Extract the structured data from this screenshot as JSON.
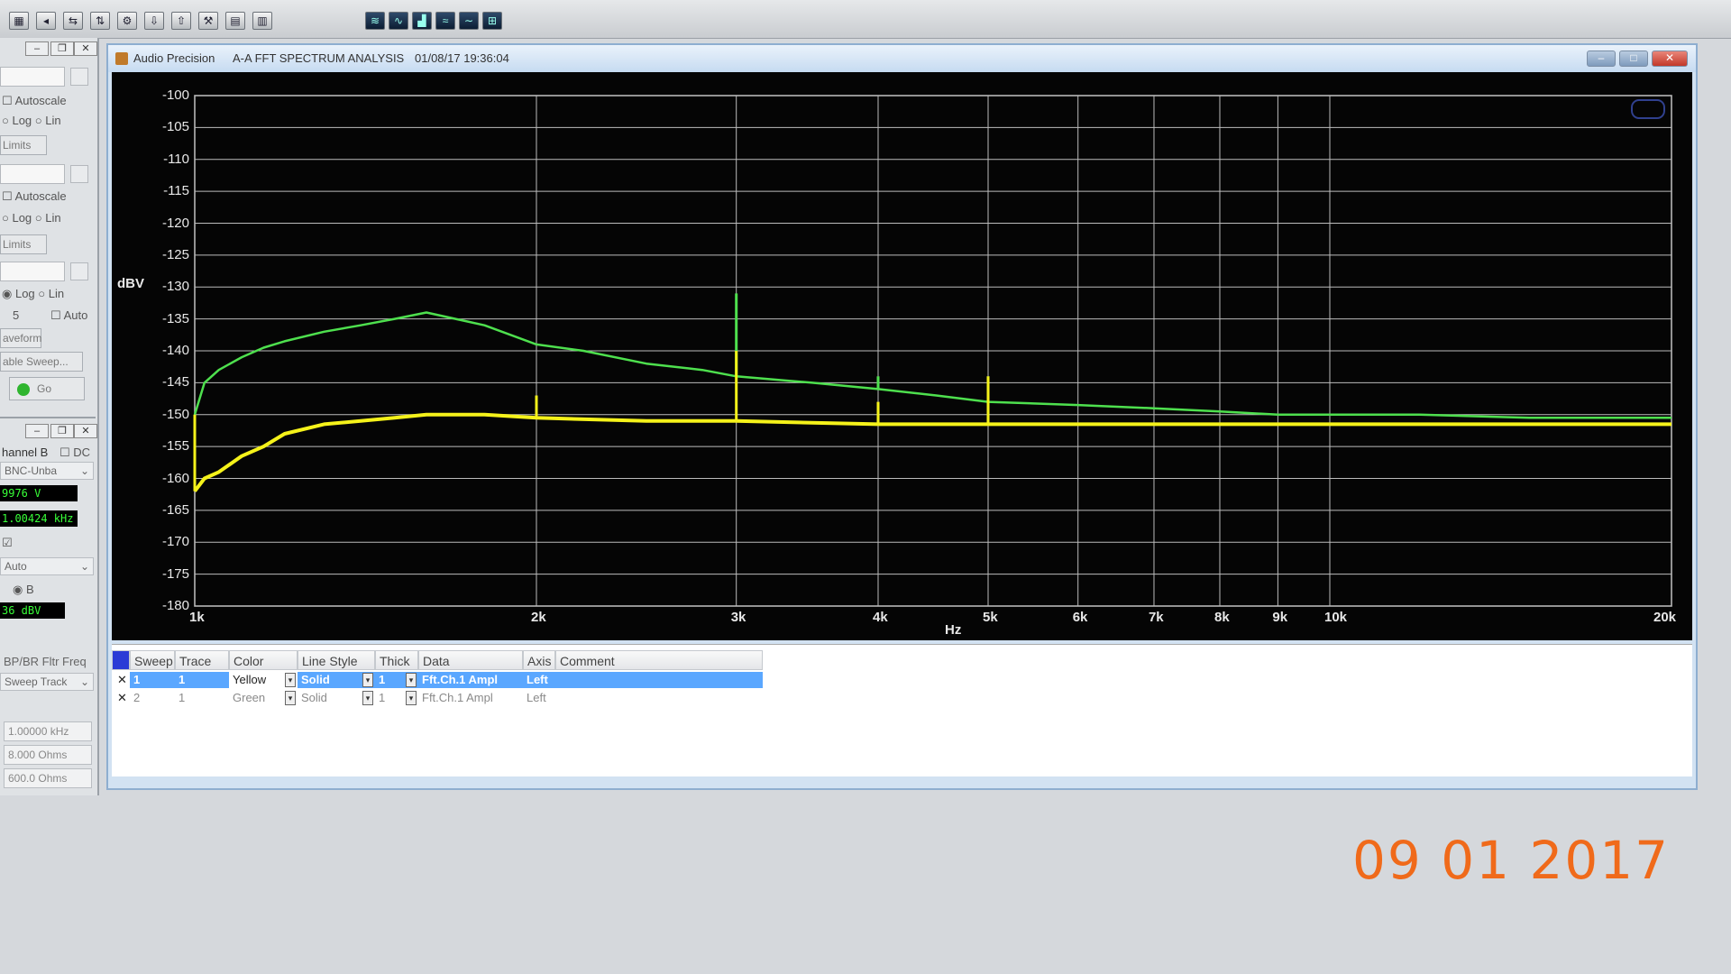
{
  "toolbar": {
    "icons": [
      "meter-icon",
      "speaker-icon",
      "switch-icon",
      "arrows-icon",
      "chart-icon",
      "import-icon",
      "export-icon",
      "settings-icon",
      "grid-icon",
      "graph-icon",
      "waveform-icon",
      "spectrum-icon",
      "bar-graph-icon",
      "fft-icon",
      "sweep-icon",
      "tree-icon"
    ]
  },
  "left_panel": {
    "autoscale_1": "Autoscale",
    "log_1": "Log",
    "lin_1": "Lin",
    "limits_1": "Limits",
    "autoscale_2": "Autoscale",
    "log_2": "Log",
    "lin_2": "Lin",
    "limits_2": "Limits",
    "log_3": "Log",
    "lin_3": "Lin",
    "steps_value": "5",
    "auto_label": "Auto",
    "waveform_btn": "aveform",
    "table_sweep_btn": "able Sweep...",
    "go_btn": "Go",
    "channel_label": "hannel B",
    "dc_label": "DC",
    "connector": "BNC-Unba",
    "voltage_reading": "9976  V",
    "freq_reading": "1.00424 kHz",
    "mode": "Auto",
    "channel_b": "B",
    "level_reading": "36 dBV",
    "bp_filter": "BP/BR Fltr Freq",
    "sweep_track": "Sweep Track",
    "freq_field": "1.00000 kHz",
    "ohms_1": "8.000    Ohms",
    "ohms_2": "600.0    Ohms"
  },
  "window": {
    "app_name": "Audio Precision",
    "title": "A-A FFT SPECTRUM ANALYSIS",
    "timestamp": "01/08/17 19:36:04",
    "controls": {
      "minimize": "–",
      "maximize": "□",
      "close": "✕"
    }
  },
  "chart_data": {
    "type": "line",
    "x_scale": "log",
    "xlim": [
      1000,
      20000
    ],
    "ylim": [
      -180,
      -100
    ],
    "y_ticks": [
      -100,
      -105,
      -110,
      -115,
      -120,
      -125,
      -130,
      -135,
      -140,
      -145,
      -150,
      -155,
      -160,
      -165,
      -170,
      -175,
      -180
    ],
    "x_ticks": [
      {
        "v": 1000,
        "label": "1k"
      },
      {
        "v": 2000,
        "label": "2k"
      },
      {
        "v": 3000,
        "label": "3k"
      },
      {
        "v": 4000,
        "label": "4k"
      },
      {
        "v": 5000,
        "label": "5k"
      },
      {
        "v": 6000,
        "label": "6k"
      },
      {
        "v": 7000,
        "label": "7k"
      },
      {
        "v": 8000,
        "label": "8k"
      },
      {
        "v": 9000,
        "label": "9k"
      },
      {
        "v": 10000,
        "label": "10k"
      },
      {
        "v": 20000,
        "label": "20k"
      }
    ],
    "ylabel": "dBV",
    "xlabel": "Hz",
    "grid": true,
    "series": [
      {
        "color": "#4ee04e",
        "x": [
          1000,
          1020,
          1050,
          1100,
          1150,
          1200,
          1300,
          1400,
          1500,
          1600,
          1800,
          2000,
          2200,
          2500,
          2800,
          3000,
          3500,
          4000,
          4500,
          5000,
          6000,
          7000,
          8000,
          9000,
          10000,
          12000,
          15000,
          18000,
          20000
        ],
        "y": [
          -150,
          -145,
          -143,
          -141,
          -139.5,
          -138.5,
          -137,
          -136,
          -135,
          -134,
          -136,
          -139,
          -140,
          -142,
          -143,
          -144,
          -145,
          -146,
          -147,
          -148,
          -148.5,
          -149,
          -149.5,
          -150,
          -150,
          -150,
          -150.5,
          -150.5,
          -150.5
        ],
        "spikes": [
          {
            "x": 3000,
            "y": -131
          },
          {
            "x": 4000,
            "y": -144
          },
          {
            "x": 5000,
            "y": -144
          }
        ]
      },
      {
        "color": "#f5f21a",
        "x": [
          1000,
          1020,
          1050,
          1100,
          1150,
          1200,
          1300,
          1400,
          1500,
          1600,
          1800,
          2000,
          2500,
          3000,
          4000,
          5000,
          6000,
          8000,
          10000,
          15000,
          20000
        ],
        "y": [
          -162,
          -160,
          -159,
          -156.5,
          -155,
          -153,
          -151.5,
          -151,
          -150.5,
          -150,
          -150,
          -150.5,
          -151,
          -151,
          -151.5,
          -151.5,
          -151.5,
          -151.5,
          -151.5,
          -151.5,
          -151.5
        ],
        "spikes": [
          {
            "x": 1000,
            "y": -150
          },
          {
            "x": 2000,
            "y": -147
          },
          {
            "x": 3000,
            "y": -140
          },
          {
            "x": 4000,
            "y": -148
          },
          {
            "x": 5000,
            "y": -144
          }
        ]
      }
    ]
  },
  "legend": {
    "headers": [
      "Sweep",
      "Trace",
      "Color",
      "Line Style",
      "Thick",
      "Data",
      "Axis",
      "Comment"
    ],
    "rows": [
      {
        "sweep": "1",
        "trace": "1",
        "color": "Yellow",
        "style": "Solid",
        "thick": "1",
        "data": "Fft.Ch.1 Ampl",
        "axis": "Left",
        "comment": ""
      },
      {
        "sweep": "2",
        "trace": "1",
        "color": "Green",
        "style": "Solid",
        "thick": "1",
        "data": "Fft.Ch.1 Ampl",
        "axis": "Left",
        "comment": ""
      }
    ]
  },
  "date_stamp": "09 01 2017"
}
